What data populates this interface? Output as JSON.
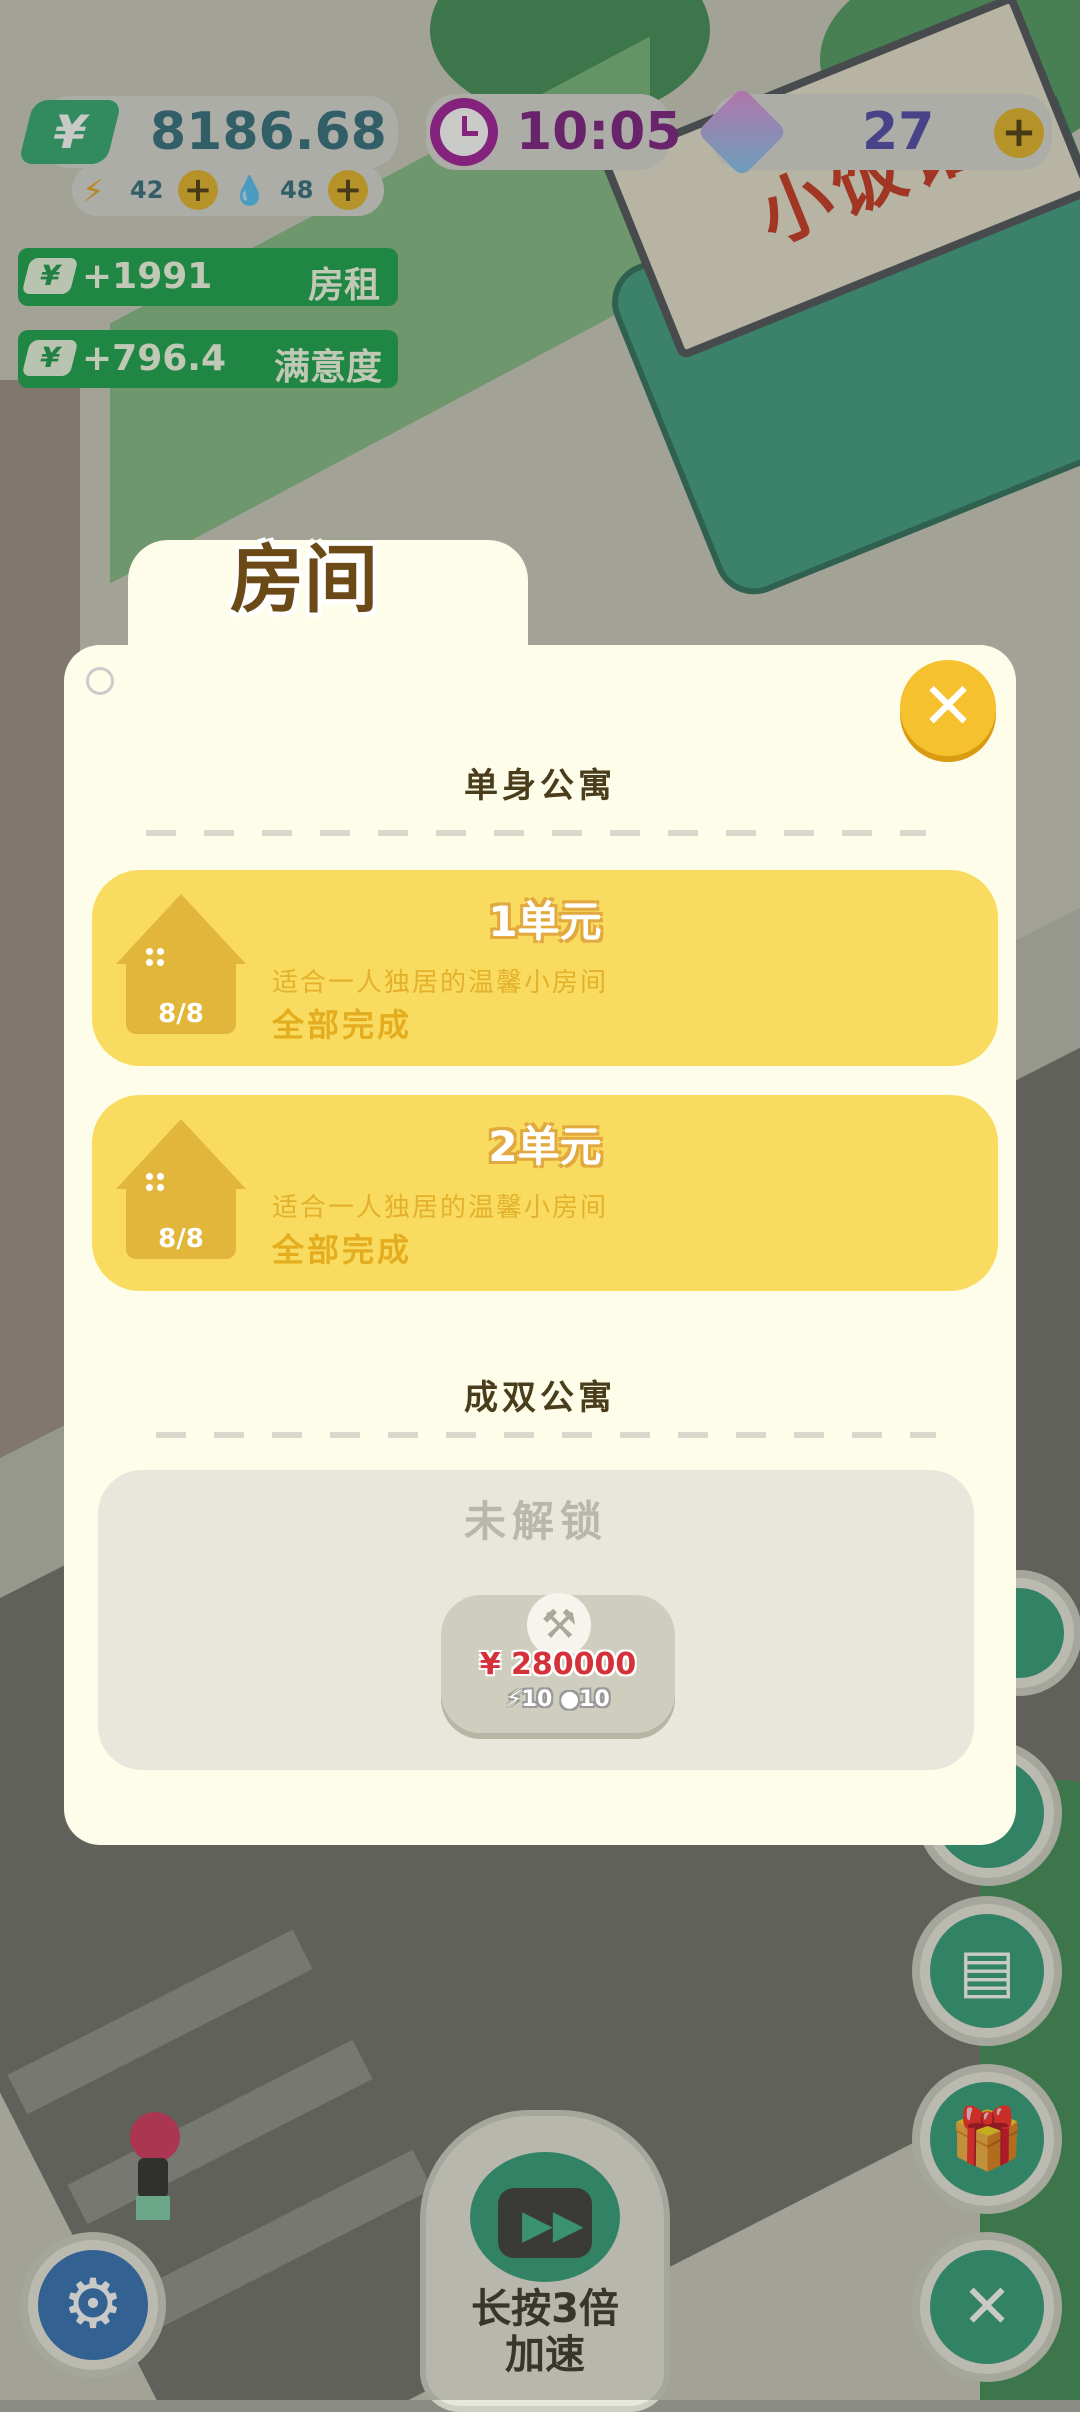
{
  "hud": {
    "money": "8186.68",
    "money_icon": "yen-icon",
    "energy": "42",
    "water": "48",
    "time": "10:05",
    "gems": "27",
    "rent_gain": "+1991",
    "rent_label": "房租",
    "satisfaction_gain": "+796.4",
    "satisfaction_label": "满意度"
  },
  "scene": {
    "restaurant_sign": "小饭馆"
  },
  "dialog": {
    "title": "房间",
    "sections": [
      {
        "title": "单身公寓",
        "units": [
          {
            "name": "1单元",
            "description": "适合一人独居的温馨小房间",
            "progress": "8/8",
            "status": "全部完成"
          },
          {
            "name": "2单元",
            "description": "适合一人独居的温馨小房间",
            "progress": "8/8",
            "status": "全部完成"
          }
        ]
      },
      {
        "title": "成双公寓",
        "locked": {
          "label": "未解锁",
          "price": "280000",
          "energy_cost": "10",
          "water_cost": "10"
        }
      }
    ]
  },
  "bottom": {
    "speed_label_line1": "长按3倍",
    "speed_label_line2": "加速"
  },
  "colors": {
    "panel": "#fdfdea",
    "unit_card": "#f9dc5f",
    "accent_green": "#15a24a",
    "close_button": "#f6c12e"
  }
}
